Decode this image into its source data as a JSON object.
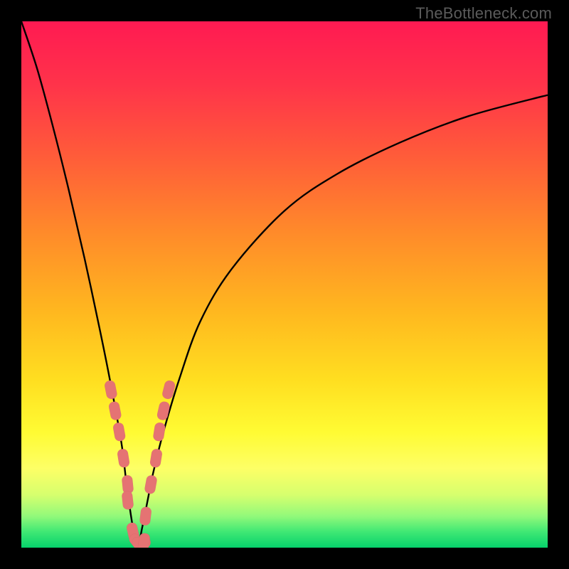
{
  "watermark": {
    "text": "TheBottleneck.com"
  },
  "chart_data": {
    "type": "line",
    "title": "",
    "xlabel": "",
    "ylabel": "",
    "xlim": [
      0,
      100
    ],
    "ylim": [
      0,
      100
    ],
    "note": "Bottleneck curve. x approximates relative hardware balance point (min near 22%). y approximates bottleneck percentage. Estimated from pixels; no axis labels shown.",
    "series": [
      {
        "name": "bottleneck-curve",
        "x": [
          0,
          3,
          6,
          9,
          12,
          15,
          17,
          19,
          20,
          21,
          22,
          23,
          24,
          25,
          27,
          30,
          34,
          40,
          50,
          60,
          72,
          85,
          100
        ],
        "y": [
          100,
          91,
          80,
          68,
          55,
          41,
          31,
          20,
          12,
          5,
          0,
          4,
          9,
          14,
          22,
          32,
          43,
          53,
          64,
          71,
          77,
          82,
          86
        ]
      },
      {
        "name": "marker-points",
        "x": [
          17.0,
          17.8,
          18.6,
          19.4,
          20.2,
          20.2,
          21.2,
          22.0,
          22.8,
          23.3,
          23.6,
          24.6,
          25.6,
          26.2,
          27.0,
          28.0
        ],
        "y": [
          30,
          26,
          22,
          17,
          12,
          9,
          3,
          1,
          1,
          1,
          6,
          12,
          17,
          22,
          26,
          30
        ]
      }
    ]
  },
  "colors": {
    "gradient_stops": [
      {
        "offset": 0.0,
        "color": "#ff1a52"
      },
      {
        "offset": 0.12,
        "color": "#ff334a"
      },
      {
        "offset": 0.25,
        "color": "#ff5a3a"
      },
      {
        "offset": 0.4,
        "color": "#ff8a2a"
      },
      {
        "offset": 0.55,
        "color": "#ffb71f"
      },
      {
        "offset": 0.68,
        "color": "#ffde20"
      },
      {
        "offset": 0.78,
        "color": "#fffb33"
      },
      {
        "offset": 0.85,
        "color": "#fdff66"
      },
      {
        "offset": 0.9,
        "color": "#d6ff6e"
      },
      {
        "offset": 0.94,
        "color": "#92f97a"
      },
      {
        "offset": 0.97,
        "color": "#3fe874"
      },
      {
        "offset": 1.0,
        "color": "#06d16b"
      }
    ],
    "curve": "#000000",
    "bead": "#e57373"
  }
}
